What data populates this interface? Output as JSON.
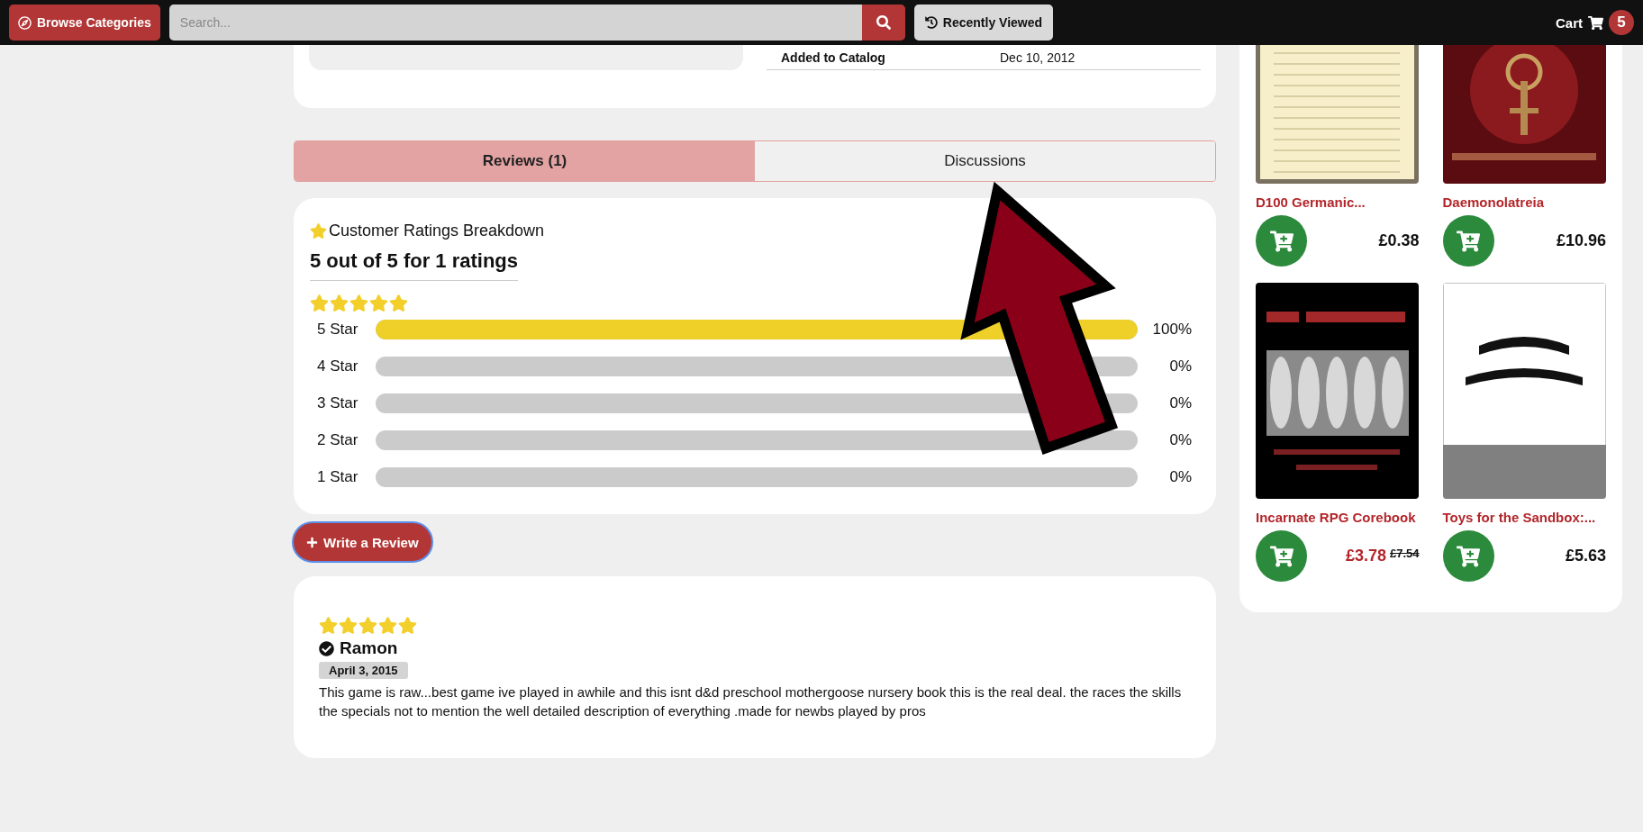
{
  "header": {
    "browse_button": "Browse Categories",
    "search": {
      "placeholder": "Search..."
    },
    "recently_viewed": "Recently Viewed",
    "cart": {
      "label": "Cart",
      "count": "5"
    }
  },
  "details": {
    "rows": [
      {
        "label": "Added to Catalog",
        "value": "Dec 10, 2012"
      }
    ]
  },
  "tabs": [
    {
      "label": "Reviews (1)",
      "selected": true
    },
    {
      "label": "Discussions",
      "selected": false
    }
  ],
  "ratings": {
    "title": "Customer Ratings Breakdown",
    "summary": "5 out of 5 for 1 ratings",
    "stars": 5,
    "rows": [
      {
        "label": "5 Star",
        "level": 1,
        "reading": "100%"
      },
      {
        "label": "4 Star",
        "level": 0,
        "reading": "0%"
      },
      {
        "label": "3 Star",
        "level": 0,
        "reading": "0%"
      },
      {
        "label": "2 Star",
        "level": 0,
        "reading": "0%"
      },
      {
        "label": "1 Star",
        "level": 0,
        "reading": "0%"
      }
    ]
  },
  "write_review": "Write a Review",
  "reviews": [
    {
      "stars": 5,
      "author": "Ramon",
      "verified": true,
      "date": "April 3, 2015",
      "text": "This game is raw...best game ive played in awhile and this isnt d&d preschool mothergoose nursery book this is the real deal. the races the skills the specials not to mention the well detailed description of everything .made for newbs played by pros"
    }
  ],
  "products": [
    {
      "title": "D100 Germanic...",
      "price": "£0.38",
      "on_sale": false
    },
    {
      "title": "Daemonolatreia",
      "price": "£10.96",
      "on_sale": false
    },
    {
      "title": "Incarnate RPG Corebook",
      "price": "£3.78",
      "old_price": "£7.54",
      "on_sale": true
    },
    {
      "title": "Toys for the Sandbox:...",
      "price": "£5.63",
      "on_sale": false
    }
  ]
}
